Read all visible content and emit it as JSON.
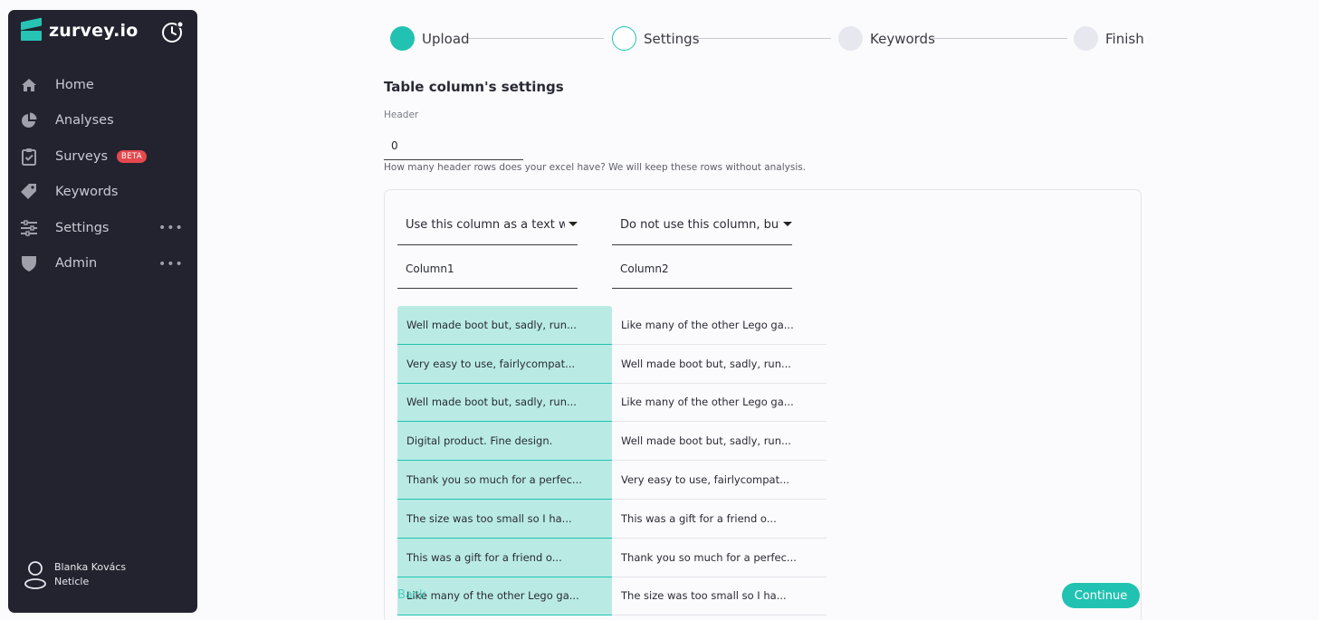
{
  "brand": {
    "name": "zurvey.io"
  },
  "sidebar": {
    "items": [
      {
        "label": "Home",
        "icon": "home-icon"
      },
      {
        "label": "Analyses",
        "icon": "pie-chart-icon"
      },
      {
        "label": "Surveys",
        "icon": "clipboard-check-icon",
        "badge": "BETA"
      },
      {
        "label": "Keywords",
        "icon": "tag-icon"
      },
      {
        "label": "Settings",
        "icon": "sliders-icon",
        "more": "•••"
      },
      {
        "label": "Admin",
        "icon": "shield-icon",
        "more": "•••"
      }
    ]
  },
  "user": {
    "name": "Blanka Kovács",
    "org": "Neticle"
  },
  "stepper": {
    "steps": [
      {
        "label": "Upload",
        "state": "done"
      },
      {
        "label": "Settings",
        "state": "active"
      },
      {
        "label": "Keywords",
        "state": "pending"
      },
      {
        "label": "Finish",
        "state": "pending"
      }
    ]
  },
  "main": {
    "title": "Table column's settings",
    "header_label": "Header",
    "header_value": "0",
    "header_help": "How many header rows does your excel have? We will keep these rows without analysis.",
    "columns": [
      {
        "usage": "Use this column as a text we",
        "name": "Column1"
      },
      {
        "usage": "Do not use this column, but l",
        "name": "Column2"
      }
    ],
    "rows": [
      [
        "Well made boot but, sadly, run...",
        "Like many of the other Lego ga..."
      ],
      [
        "Very easy to use, fairlycompat...",
        "Well made boot but, sadly, run..."
      ],
      [
        "Well made boot but, sadly, run...",
        "Like many of the other Lego ga..."
      ],
      [
        "Digital product. Fine design.",
        "Well made boot but, sadly, run..."
      ],
      [
        "Thank you so much for a perfec...",
        "Very easy to use, fairlycompat..."
      ],
      [
        "The size was too small so I ha...",
        "This was a gift for a friend o..."
      ],
      [
        "This was a gift for a friend o...",
        "Thank you so much for a perfec..."
      ],
      [
        "Like many of the other Lego ga...",
        "The size was too small so I ha..."
      ]
    ],
    "back_label": "Back",
    "continue_label": "Continue"
  },
  "colors": {
    "accent": "#22c2b2",
    "accent_light": "#b9ebe4",
    "sidebar_bg": "#22232f",
    "pending_step": "#e6e7ef",
    "beta_badge": "#e5484d"
  }
}
